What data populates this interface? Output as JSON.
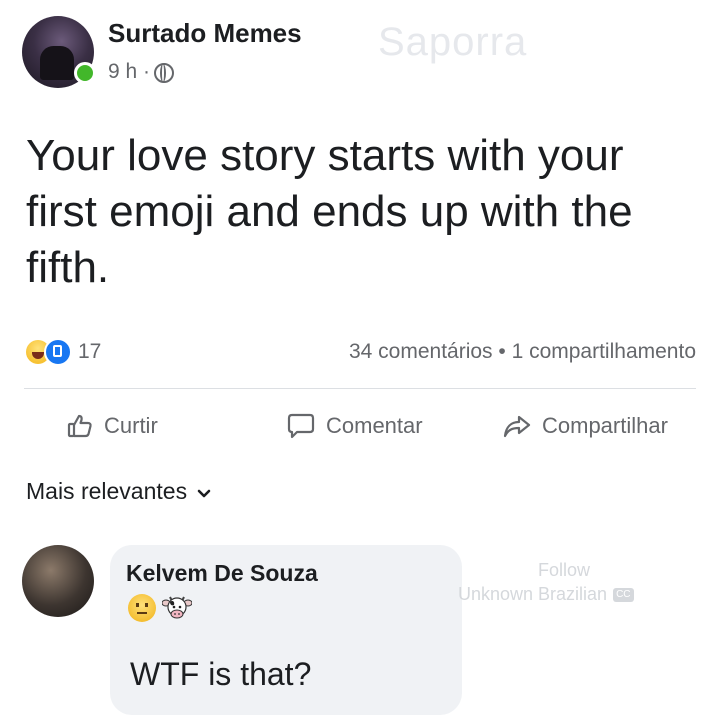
{
  "post": {
    "page_name": "Surtado Memes",
    "time": "9 h ·",
    "privacy_icon": "globe-icon",
    "watermark": "Saporra",
    "text": "Your love story starts with your first emoji and ends up with the fifth."
  },
  "engagement": {
    "reaction_icons": [
      "haha-reaction-icon",
      "like-reaction-icon"
    ],
    "reaction_count": "17",
    "stats": "34 comentários • 1 compartilhamento"
  },
  "actions": {
    "like": "Curtir",
    "comment": "Comentar",
    "share": "Compartilhar"
  },
  "comments": {
    "sort_label": "Mais relevantes",
    "items": [
      {
        "author": "Kelvem De Souza",
        "emojis": [
          "neutral-face-emoji",
          "cow-emoji"
        ],
        "text": "WTF is that?"
      }
    ]
  },
  "watermarks": {
    "follow": "Follow",
    "brand": "Unknown Brazilian",
    "badge": "CC"
  },
  "colors": {
    "like_blue": "#1877f2",
    "online_green": "#42b72a",
    "secondary_text": "#65676b",
    "bubble_bg": "#f0f2f5"
  }
}
